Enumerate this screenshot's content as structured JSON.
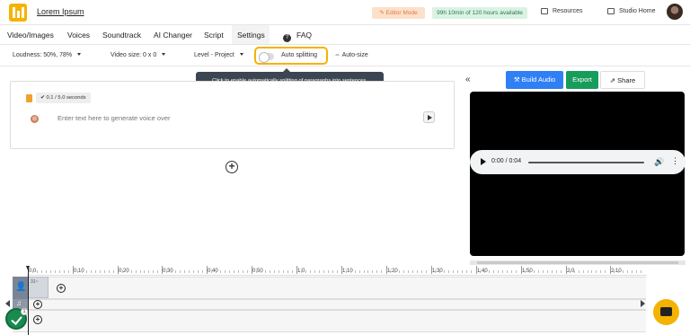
{
  "header": {
    "project_name": "Lorem Ipsum",
    "editor_mode": "Editor Mode",
    "time_available": "99h 10min of 120 hours available",
    "resources": "Resources",
    "studio_home": "Studio Home"
  },
  "tabs": [
    {
      "label": "Video/Images"
    },
    {
      "label": "Voices"
    },
    {
      "label": "Soundtrack"
    },
    {
      "label": "AI Changer"
    },
    {
      "label": "Script"
    },
    {
      "label": "Settings",
      "active": true
    },
    {
      "label": "FAQ"
    }
  ],
  "toolbar": {
    "loudness": "Loudness: 50%, 78%",
    "video_size": "Video size: 0 x 0",
    "level": "Level - Project",
    "auto_splitting": "Auto splitting",
    "auto_size": "Auto-size"
  },
  "tooltip": "Click to enable automatically splitting of paragraphs into sentences.",
  "editor": {
    "duration": "0.1 / 5.0 seconds",
    "placeholder": "Enter text here to generate voice over"
  },
  "actions": {
    "build_audio": "Build Audio",
    "export": "Export",
    "share": "Share"
  },
  "audio_player": {
    "time": "0:00 / 0:04"
  },
  "timeline": {
    "ticks": [
      "0:0",
      "0:10",
      "0:20",
      "0:30",
      "0:40",
      "0:50",
      "1:0",
      "1:10",
      "1:20",
      "1:30",
      "1:40",
      "1:50",
      "2:0",
      "2:10"
    ],
    "clip_label": "31~",
    "badge_count": "1"
  },
  "colors": {
    "accent_yellow": "#f5b301",
    "build_blue": "#2f7ff5",
    "export_green": "#179c5c"
  }
}
